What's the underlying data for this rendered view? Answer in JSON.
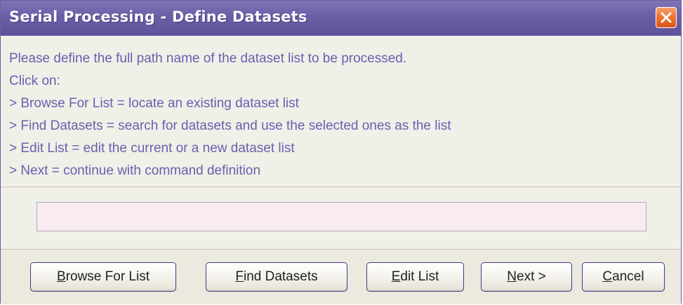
{
  "window": {
    "title": "Serial Processing - Define Datasets"
  },
  "info": {
    "lines": [
      "Please define the full path name of the dataset list to be processed.",
      "Click on:",
      "> Browse For List = locate an existing dataset list",
      "> Find Datasets = search for datasets and use the selected ones as the list",
      "> Edit List = edit the current or a new dataset list",
      "> Next = continue with command definition"
    ]
  },
  "path_field": {
    "value": "",
    "placeholder": ""
  },
  "buttons": {
    "browse": {
      "mnemonic": "B",
      "rest": "rowse For List"
    },
    "find": {
      "mnemonic": "F",
      "rest": "ind Datasets"
    },
    "edit": {
      "mnemonic": "E",
      "rest": "dit List"
    },
    "next": {
      "mnemonic": "N",
      "rest": "ext >"
    },
    "cancel": {
      "mnemonic": "C",
      "rest": "ancel"
    }
  },
  "icons": {
    "close": "close-icon"
  },
  "colors": {
    "titlebar": "#6a5fa6",
    "info_text": "#6b5fae",
    "close_button": "#ec6f2d",
    "input_background": "#f9ecf0"
  }
}
